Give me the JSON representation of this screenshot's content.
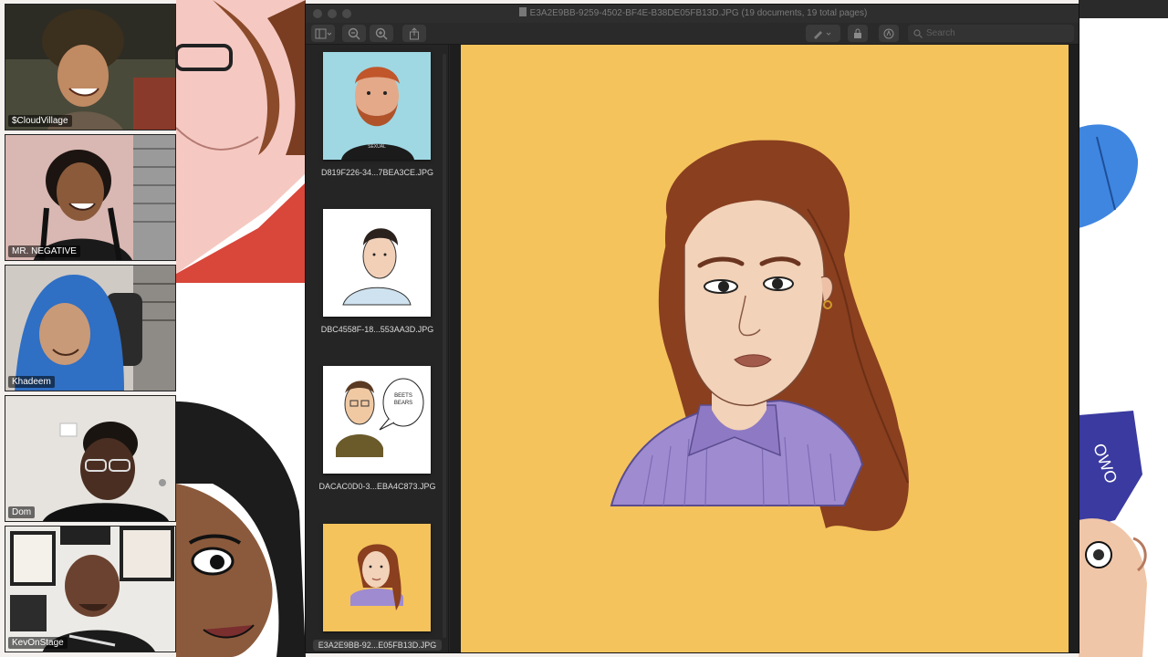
{
  "participants": [
    {
      "name": "$CloudVillage"
    },
    {
      "name": "MR. NEGATIVE"
    },
    {
      "name": "Khadeem"
    },
    {
      "name": "Dom"
    },
    {
      "name": "KevOnStage"
    }
  ],
  "preview": {
    "window_title": "E3A2E9BB-9259-4502-BF4E-B38DE05FB13D.JPG (19 documents, 19 total pages)",
    "search_placeholder": "Search",
    "thumbnails": [
      {
        "label": "D819F226-34...7BEA3CE.JPG",
        "bg": "#9fd8e3"
      },
      {
        "label": "DBC4558F-18...553AA3D.JPG",
        "bg": "#ffffff"
      },
      {
        "label": "DACAC0D0-3...EBA4C873.JPG",
        "bg": "#ffffff"
      },
      {
        "label": "E3A2E9BB-92...E05FB13D.JPG",
        "bg": "#f4c35c"
      }
    ],
    "selected_index": 3
  },
  "colors": {
    "accent_yellow": "#f4c35c",
    "hair_brown": "#8a3f1f",
    "shirt_purple": "#9f8bd0",
    "skin": "#f2d2b8"
  }
}
